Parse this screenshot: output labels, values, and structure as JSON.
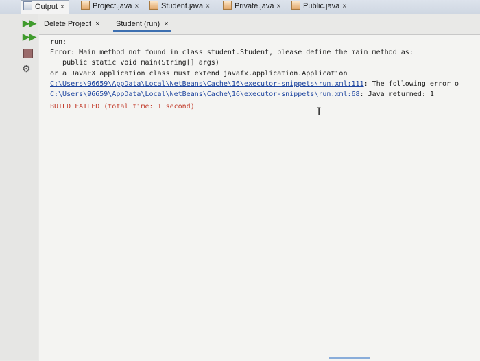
{
  "tabs": [
    {
      "label": "Output",
      "active": true,
      "icon": "output-window-icon"
    },
    {
      "label": "Project.java",
      "icon": "java-file-icon"
    },
    {
      "label": "Student.java",
      "icon": "java-file-icon"
    },
    {
      "label": "Private.java",
      "icon": "java-file-icon"
    },
    {
      "label": "Public.java",
      "icon": "java-file-icon"
    }
  ],
  "close_glyph": "×",
  "toolbar": {
    "rerun_icon": "rerun-icon",
    "rerun2_icon": "rerun-with-changes-icon",
    "stop_icon": "stop-icon",
    "settings_icon": "settings-icon"
  },
  "subtabs": [
    {
      "label": "Delete Project",
      "active": false
    },
    {
      "label": "Student (run)",
      "active": true
    }
  ],
  "console": {
    "lines": [
      {
        "text": "run:",
        "style": "black"
      },
      {
        "text": "Error: Main method not found in class student.Student, please define the main method as:",
        "style": "black"
      },
      {
        "text": "   public static void main(String[] args)",
        "style": "black"
      },
      {
        "text": "or a JavaFX application class must extend javafx.application.Application",
        "style": "black"
      },
      {
        "link": "C:\\Users\\96659\\AppData\\Local\\NetBeans\\Cache\\16\\executor-snippets\\run.xml:111",
        "rest": ": The following error o",
        "style": "link"
      },
      {
        "link": "C:\\Users\\96659\\AppData\\Local\\NetBeans\\Cache\\16\\executor-snippets\\run.xml:68",
        "rest": ": Java returned: 1",
        "style": "link"
      },
      {
        "text": "BUILD FAILED (total time: 1 second)",
        "style": "red"
      }
    ]
  },
  "colors": {
    "link": "#1f46a0",
    "error": "#c23b2a",
    "accent": "#3d6fb0",
    "run_green": "#3f9b2c"
  }
}
